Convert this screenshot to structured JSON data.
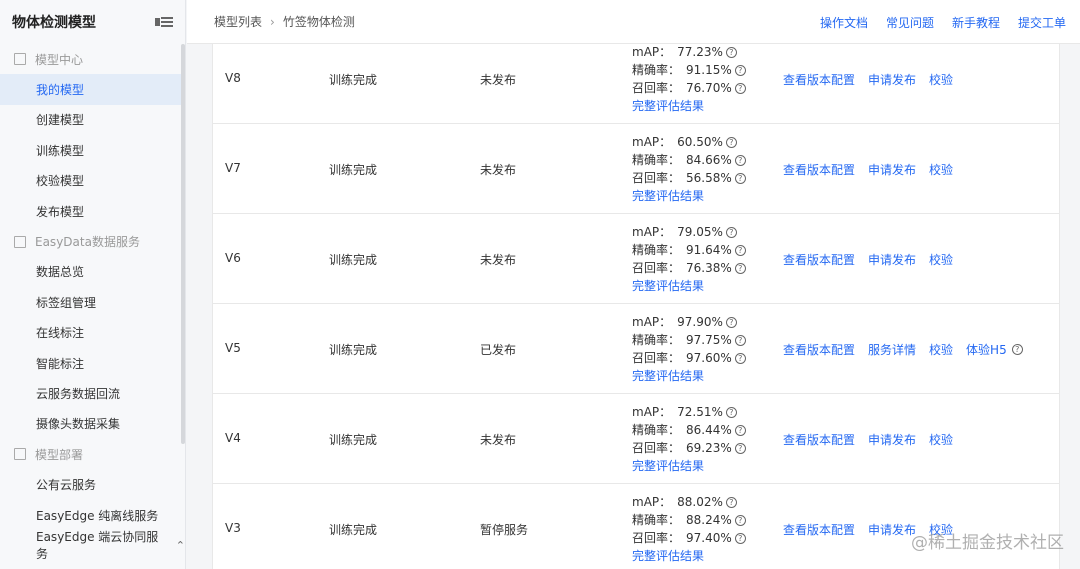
{
  "sidebar": {
    "title": "物体检测模型",
    "groups": [
      {
        "label": "模型中心",
        "icon": "model-center-icon"
      },
      {
        "label": "EasyData数据服务",
        "icon": "easydata-icon"
      },
      {
        "label": "模型部署",
        "icon": "deploy-icon"
      }
    ],
    "items": [
      {
        "label": "我的模型"
      },
      {
        "label": "创建模型"
      },
      {
        "label": "训练模型"
      },
      {
        "label": "校验模型"
      },
      {
        "label": "发布模型"
      },
      {
        "label": "数据总览"
      },
      {
        "label": "标签组管理"
      },
      {
        "label": "在线标注"
      },
      {
        "label": "智能标注"
      },
      {
        "label": "云服务数据回流"
      },
      {
        "label": "摄像头数据采集"
      },
      {
        "label": "公有云服务"
      },
      {
        "label": "EasyEdge 纯离线服务"
      },
      {
        "label": "EasyEdge 端云协同服务"
      }
    ]
  },
  "breadcrumb": {
    "parent": "模型列表",
    "separator": "›",
    "current": "竹签物体检测"
  },
  "toplinks": [
    "操作文档",
    "常见问题",
    "新手教程",
    "提交工单"
  ],
  "metric_labels": {
    "map": "mAP：",
    "precision": "精确率：",
    "recall": "召回率：",
    "eval": "完整评估结果"
  },
  "rows": [
    {
      "version": "V8",
      "status": "训练完成",
      "publish": "未发布",
      "map": "77.23%",
      "precision": "91.15%",
      "recall": "76.70%",
      "actions": [
        "查看版本配置",
        "申请发布",
        "校验"
      ]
    },
    {
      "version": "V7",
      "status": "训练完成",
      "publish": "未发布",
      "map": "60.50%",
      "precision": "84.66%",
      "recall": "56.58%",
      "actions": [
        "查看版本配置",
        "申请发布",
        "校验"
      ]
    },
    {
      "version": "V6",
      "status": "训练完成",
      "publish": "未发布",
      "map": "79.05%",
      "precision": "91.64%",
      "recall": "76.38%",
      "actions": [
        "查看版本配置",
        "申请发布",
        "校验"
      ]
    },
    {
      "version": "V5",
      "status": "训练完成",
      "publish": "已发布",
      "map": "97.90%",
      "precision": "97.75%",
      "recall": "97.60%",
      "actions": [
        "查看版本配置",
        "服务详情",
        "校验",
        "体验H5"
      ]
    },
    {
      "version": "V4",
      "status": "训练完成",
      "publish": "未发布",
      "map": "72.51%",
      "precision": "86.44%",
      "recall": "69.23%",
      "actions": [
        "查看版本配置",
        "申请发布",
        "校验"
      ]
    },
    {
      "version": "V3",
      "status": "训练完成",
      "publish": "暂停服务",
      "map": "88.02%",
      "precision": "88.24%",
      "recall": "97.40%",
      "actions": [
        "查看版本配置",
        "申请发布",
        "校验"
      ]
    }
  ],
  "watermark": "@稀土掘金技术社区",
  "colors": {
    "link": "#2468f2",
    "active_bg": "#e3ecf8"
  }
}
